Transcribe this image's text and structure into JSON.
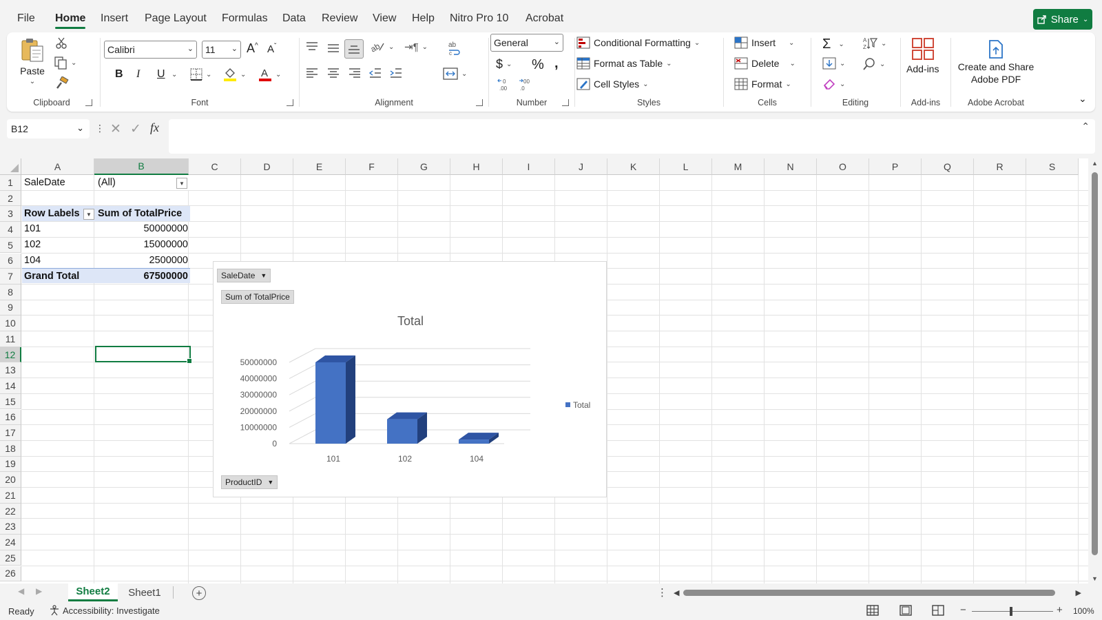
{
  "menu": {
    "tabs": [
      "File",
      "Home",
      "Insert",
      "Page Layout",
      "Formulas",
      "Data",
      "Review",
      "View",
      "Help",
      "Nitro Pro 10",
      "Acrobat"
    ],
    "active": "Home",
    "share_label": "Share"
  },
  "ribbon": {
    "clipboard": {
      "label": "Clipboard",
      "paste": "Paste"
    },
    "font": {
      "label": "Font",
      "font_name": "Calibri",
      "font_size": "11",
      "bold": "B",
      "italic": "I",
      "underline": "U"
    },
    "alignment": {
      "label": "Alignment"
    },
    "number": {
      "label": "Number",
      "format": "General"
    },
    "styles": {
      "label": "Styles",
      "conditional": "Conditional Formatting",
      "format_table": "Format as Table",
      "cell_styles": "Cell Styles"
    },
    "cells": {
      "label": "Cells",
      "insert": "Insert",
      "delete": "Delete",
      "format": "Format"
    },
    "editing": {
      "label": "Editing"
    },
    "addins": {
      "label": "Add-ins",
      "button": "Add-ins"
    },
    "acrobat": {
      "label": "Adobe Acrobat",
      "button_line1": "Create and Share",
      "button_line2": "Adobe PDF"
    }
  },
  "formula_bar": {
    "name_box": "B12",
    "fx": "fx",
    "value": ""
  },
  "grid": {
    "columns": [
      "A",
      "B",
      "C",
      "D",
      "E",
      "F",
      "G",
      "H",
      "I",
      "J",
      "K",
      "L",
      "M",
      "N",
      "O",
      "P",
      "Q",
      "R",
      "S"
    ],
    "rows": [
      "1",
      "2",
      "3",
      "4",
      "5",
      "6",
      "7",
      "8",
      "9",
      "10",
      "11",
      "12",
      "13",
      "14",
      "15",
      "16",
      "17",
      "18",
      "19",
      "20",
      "21",
      "22",
      "23",
      "24",
      "25",
      "26"
    ],
    "selected_column": "B",
    "selected_row": "12"
  },
  "pivot": {
    "filter_field": "SaleDate",
    "filter_value": "(All)",
    "row_labels": "Row Labels",
    "value_header": "Sum of TotalPrice",
    "rows": [
      {
        "label": "101",
        "value": "50000000"
      },
      {
        "label": "102",
        "value": "15000000"
      },
      {
        "label": "104",
        "value": "2500000"
      }
    ],
    "grand_total_label": "Grand Total",
    "grand_total_value": "67500000"
  },
  "chart": {
    "filter_button": "SaleDate",
    "value_button": "Sum of TotalPrice",
    "axis_button": "ProductID",
    "legend_label": "Total",
    "bar_color": "#4472c4"
  },
  "chart_data": {
    "type": "bar",
    "title": "Total",
    "categories": [
      "101",
      "102",
      "104"
    ],
    "series": [
      {
        "name": "Total",
        "values": [
          50000000,
          15000000,
          2500000
        ]
      }
    ],
    "y_ticks": [
      "0",
      "10000000",
      "20000000",
      "30000000",
      "40000000",
      "50000000"
    ],
    "ylim": [
      0,
      50000000
    ],
    "legend": "right",
    "grid": true
  },
  "sheets": {
    "tabs": [
      "Sheet2",
      "Sheet1"
    ],
    "active": "Sheet2"
  },
  "status": {
    "ready": "Ready",
    "accessibility": "Accessibility: Investigate",
    "zoom": "100%"
  }
}
